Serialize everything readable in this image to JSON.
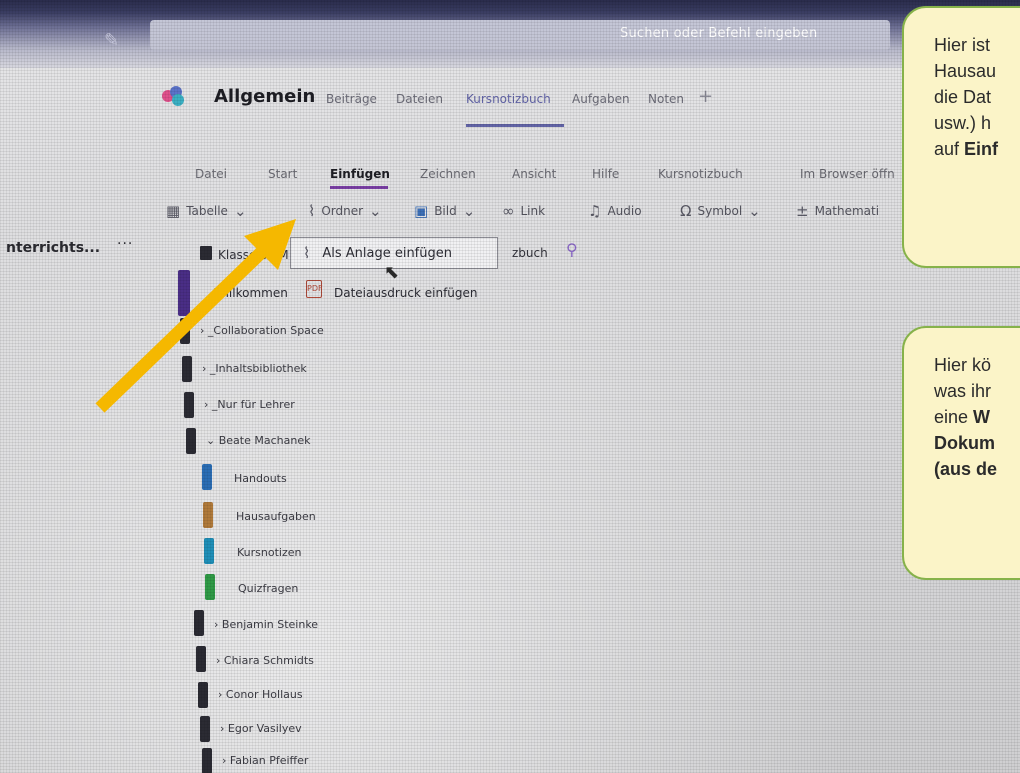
{
  "search": {
    "placeholder": "Suchen oder Befehl eingeben"
  },
  "channel": {
    "title": "Allgemein",
    "tabs": [
      {
        "label": "Beiträge"
      },
      {
        "label": "Dateien"
      },
      {
        "label": "Kursnotizbuch",
        "active": true
      },
      {
        "label": "Aufgaben"
      },
      {
        "label": "Noten"
      }
    ],
    "add_tab": "+"
  },
  "ribbon": {
    "tabs": [
      {
        "label": "Datei"
      },
      {
        "label": "Start"
      },
      {
        "label": "Einfügen",
        "active": true
      },
      {
        "label": "Zeichnen"
      },
      {
        "label": "Ansicht"
      },
      {
        "label": "Hilfe"
      },
      {
        "label": "Kursnotizbuch"
      },
      {
        "label": "Im Browser öffn"
      }
    ],
    "tools": [
      {
        "icon": "table-icon",
        "label": "Tabelle"
      },
      {
        "icon": "paperclip-icon",
        "label": "Ordner"
      },
      {
        "icon": "picture-icon",
        "label": "Bild"
      },
      {
        "icon": "link-icon",
        "label": "Link"
      },
      {
        "icon": "audio-icon",
        "label": "Audio"
      },
      {
        "icon": "omega-icon",
        "label": "Symbol"
      },
      {
        "icon": "math-icon",
        "label": "Mathemati"
      }
    ]
  },
  "left_panel": {
    "title": "nterrichts...",
    "more": "···"
  },
  "notebook": {
    "name": "Klasse 5c M",
    "right_text": "zbuch"
  },
  "dropdown": {
    "item": "Als Anlage einfügen"
  },
  "welcome": {
    "label": "Willkommen",
    "print_label": "Dateiausdruck einfügen"
  },
  "sections": [
    {
      "label": "_Collaboration Space",
      "collapsed": true
    },
    {
      "label": "_Inhaltsbibliothek",
      "collapsed": true
    },
    {
      "label": "_Nur für Lehrer",
      "collapsed": true
    },
    {
      "label": "Beate Machanek",
      "collapsed": false
    }
  ],
  "pages": [
    {
      "label": "Handouts",
      "color": "#2a6db5"
    },
    {
      "label": "Hausaufgaben",
      "color": "#b07a3a"
    },
    {
      "label": "Kursnotizen",
      "color": "#1f8fb8"
    },
    {
      "label": "Quizfragen",
      "color": "#2f9a46"
    }
  ],
  "students": [
    {
      "label": "Benjamin Steinke"
    },
    {
      "label": "Chiara Schmidts"
    },
    {
      "label": "Conor Hollaus"
    },
    {
      "label": "Egor Vasilyev"
    },
    {
      "label": "Fabian Pfeiffer"
    }
  ],
  "callouts": {
    "top": {
      "line1": "Hier ist",
      "line2": "Hausau",
      "line3": "die Dat",
      "line4": "usw.) h",
      "line5_a": "auf ",
      "line5_b": "Einf"
    },
    "bottom": {
      "line1": "Hier kö",
      "line2": "was ihr",
      "line3_a": "eine ",
      "line3_b": "W",
      "line4": "Dokum",
      "line5": "(aus de"
    }
  },
  "colors": {
    "accent": "#6264a7",
    "arrow": "#f5b800",
    "callout_bg": "#fbf4c8",
    "callout_border": "#86b24a"
  }
}
